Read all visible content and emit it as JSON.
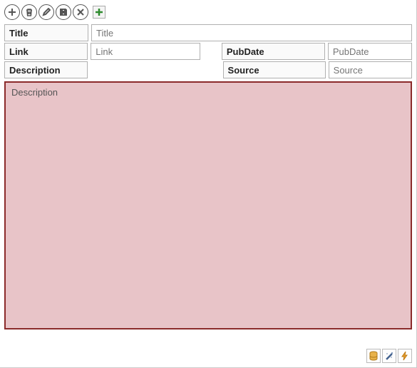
{
  "toolbar": {
    "add_title": "Add",
    "delete_title": "Delete",
    "edit_title": "Edit",
    "save_title": "Save",
    "close_title": "Close",
    "new_title": "New"
  },
  "fields": {
    "title_label": "Title",
    "title_placeholder": "Title",
    "link_label": "Link",
    "link_placeholder": "Link",
    "pubdate_label": "PubDate",
    "pubdate_placeholder": "PubDate",
    "description_label": "Description",
    "description_placeholder": "Description",
    "source_label": "Source",
    "source_placeholder": "Source"
  },
  "footer": {
    "db_title": "Database",
    "wand_title": "Tools",
    "bolt_title": "Action"
  }
}
